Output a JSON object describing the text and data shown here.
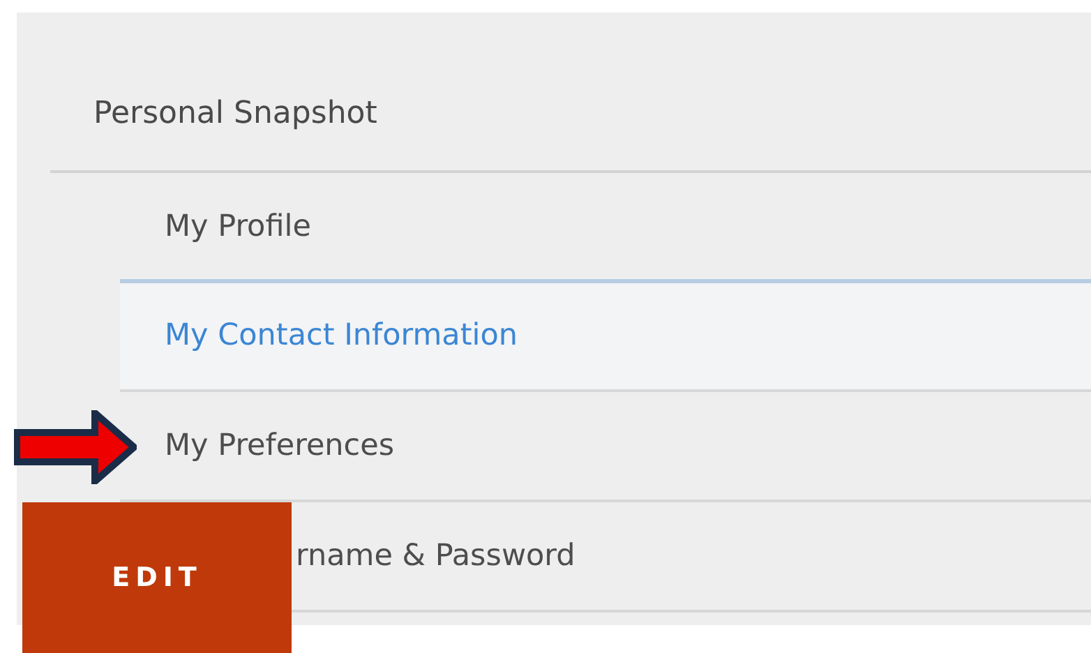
{
  "panel": {
    "heading": "Personal Snapshot",
    "items": [
      {
        "label": "My Profile",
        "selected": false
      },
      {
        "label": "My Contact Information",
        "selected": true
      },
      {
        "label": "My Preferences",
        "selected": false
      },
      {
        "label": "rname & Password",
        "selected": false,
        "kind": "covered"
      }
    ]
  },
  "edit_button": {
    "label": "EDIT"
  }
}
